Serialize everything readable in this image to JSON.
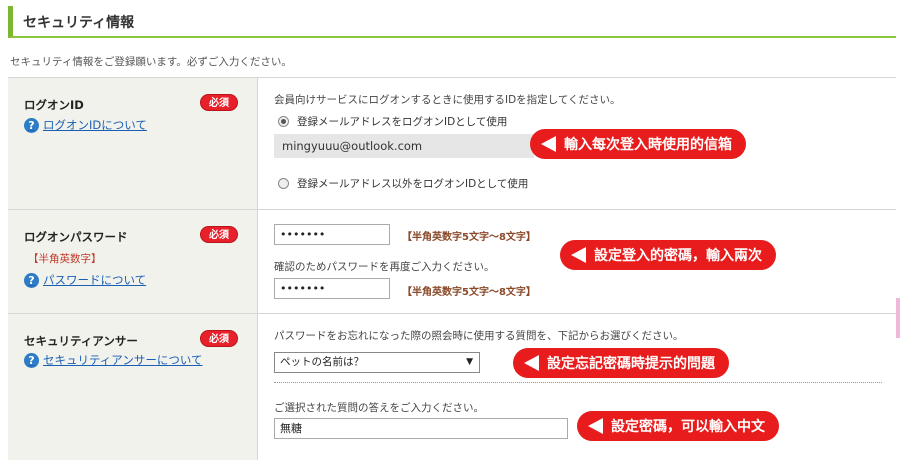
{
  "section": {
    "title": "セキュリティ情報"
  },
  "intro": "セキュリティ情報をご登録願います。必ずご入力ください。",
  "required_label": "必須",
  "logon_id": {
    "label": "ログオンID",
    "help_link": "ログオンIDについて",
    "instruction": "会員向けサービスにログオンするときに使用するIDを指定してください。",
    "option_email": "登録メールアドレスをログオンIDとして使用",
    "email_value": "mingyuuu@outlook.com",
    "option_other": "登録メールアドレス以外をログオンIDとして使用",
    "callout": "輸入每次登入時使用的信箱"
  },
  "password": {
    "label": "ログオンパスワード",
    "sub_label": "【半角英数字】",
    "help_link": "パスワードについて",
    "value": "•••••••",
    "hint": "【半角英数字5文字～8文字】",
    "confirm_instruction": "確認のためパスワードを再度ご入力ください。",
    "confirm_value": "•••••••",
    "confirm_hint": "【半角英数字5文字～8文字】",
    "callout": "設定登入的密碼，輸入兩次"
  },
  "security_answer": {
    "label": "セキュリティアンサー",
    "help_link": "セキュリティアンサーについて",
    "instruction": "パスワードをお忘れになった際の照会時に使用する質問を、下記からお選びください。",
    "selected_question": "ペットの名前は？",
    "answer_instruction": "ご選択された質問の答えをご入力ください。",
    "answer_value": "無糖",
    "callout_question": "設定忘記密碼時提示的問題",
    "callout_answer": "設定密碼，可以輸入中文"
  },
  "colors": {
    "accent": "#8cc63f",
    "required": "#e8202a",
    "callout": "#e81c1c",
    "link": "#1a5fb4"
  }
}
